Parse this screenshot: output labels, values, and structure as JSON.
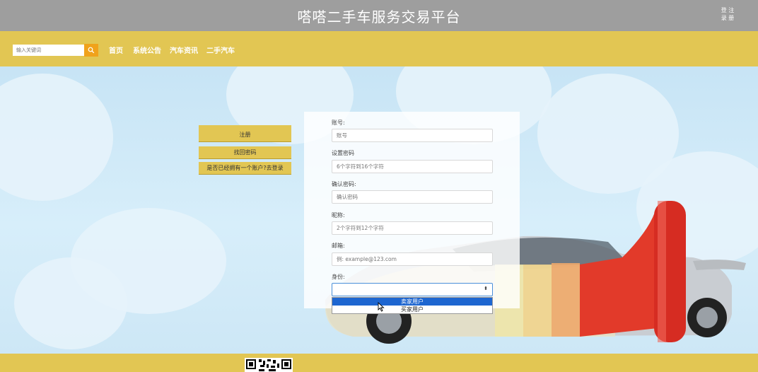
{
  "header": {
    "title": "嗒嗒二手车服务交易平台",
    "register_link": "登  注",
    "login_link": "录  册"
  },
  "nav": {
    "search_placeholder": "输入关键词",
    "items": [
      "首页",
      "系统公告",
      "汽车资讯",
      "二手汽车"
    ]
  },
  "side": {
    "register": "注册",
    "forgot": "找回密码",
    "have_account": "是否已经拥有一个账户?去登录"
  },
  "form": {
    "account_label": "账号:",
    "account_placeholder": "账号",
    "password_label": "设置密码",
    "password_placeholder": "6个字符到16个字符",
    "confirm_label": "确认密码:",
    "confirm_placeholder": "确认密码",
    "nickname_label": "昵称:",
    "nickname_placeholder": "2个字符到12个字符",
    "email_label": "邮箱:",
    "email_placeholder": "例: example@123.com",
    "identity_label": "身份:",
    "identity_options": [
      "卖家用户",
      "买家用户"
    ]
  },
  "colors": {
    "topbar": "#9e9e9e",
    "nav": "#e2c653",
    "search_button": "#f0a21b",
    "selected_option": "#1e66d0"
  }
}
